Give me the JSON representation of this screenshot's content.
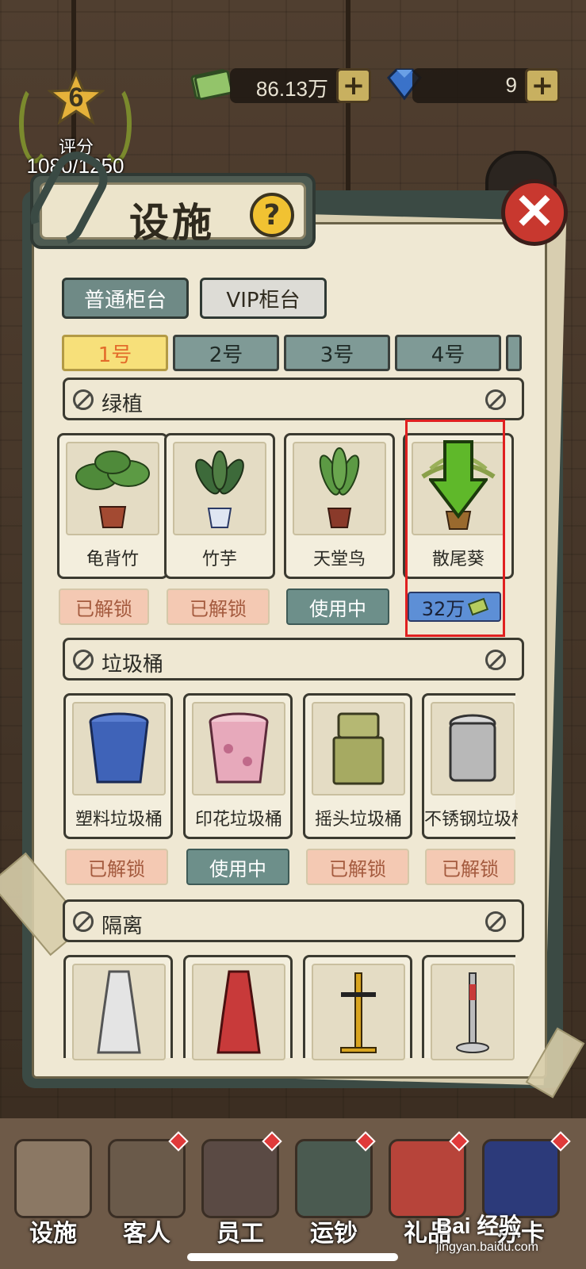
{
  "hud": {
    "rating_level": "6",
    "rating_label": "评分",
    "rating_score": "1080/1250",
    "cash_amount": "86.13万",
    "gem_amount": "9"
  },
  "modal": {
    "title": "设施",
    "help_label": "?",
    "close_label": "✕",
    "counter_types": [
      "普通柜台",
      "VIP柜台"
    ],
    "counter_numbers": [
      "1号",
      "2号",
      "3号",
      "4号"
    ]
  },
  "sections": {
    "plants": {
      "title": "绿植",
      "items": [
        {
          "name": "龟背竹",
          "status": "已解锁"
        },
        {
          "name": "竹芋",
          "status": "已解锁"
        },
        {
          "name": "天堂鸟",
          "status": "使用中"
        },
        {
          "name": "散尾葵",
          "status": "32万"
        }
      ]
    },
    "bins": {
      "title": "垃圾桶",
      "items": [
        {
          "name": "塑料垃圾桶",
          "status": "已解锁"
        },
        {
          "name": "印花垃圾桶",
          "status": "使用中"
        },
        {
          "name": "摇头垃圾桶",
          "status": "已解锁"
        },
        {
          "name": "不锈钢垃圾桶",
          "status": "已解锁"
        }
      ]
    },
    "barriers": {
      "title": "隔离"
    }
  },
  "nav": [
    "设施",
    "客人",
    "员工",
    "运钞",
    "礼品",
    "办卡"
  ],
  "watermark": {
    "logo": "Bai 经验",
    "url": "jingyan.baidu.com"
  },
  "colors": {
    "highlight": "#e02020",
    "active_tab": "#f7e07a",
    "in_use": "#6d8f8a",
    "price": "#5d8fd6"
  }
}
